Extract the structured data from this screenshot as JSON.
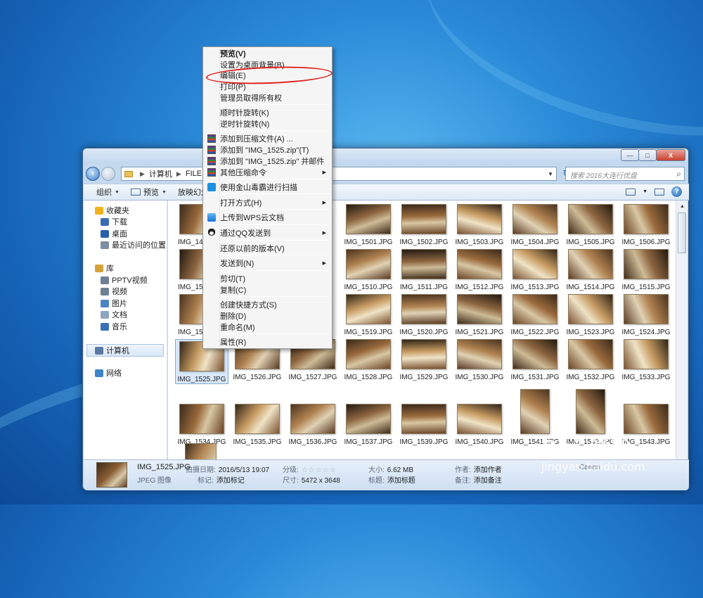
{
  "window": {
    "address": {
      "crumbs": [
        "计算机",
        "FILEBAK ("
      ]
    },
    "search_placeholder": "搜索 2016大连行优盘",
    "toolbar": {
      "organize": "组织",
      "preview": "预览",
      "slideshow": "放映幻灯片"
    },
    "caption_buttons": {
      "minimize": "—",
      "maximize": "□",
      "close": "X"
    },
    "nav": [
      {
        "label": "收藏夹",
        "icon": "star-icon",
        "color": "#f0b21e"
      },
      {
        "label": "下载",
        "icon": "download-icon",
        "color": "#3b6db3"
      },
      {
        "label": "桌面",
        "icon": "desktop-icon",
        "color": "#2b5fa8"
      },
      {
        "label": "最近访问的位置",
        "icon": "recent-places-icon",
        "color": "#7d8da2"
      },
      {
        "label": "库",
        "icon": "library-icon",
        "color": "#d8a23a"
      },
      {
        "label": "PPTV视频",
        "icon": "video-icon",
        "color": "#6f7f95"
      },
      {
        "label": "视频",
        "icon": "video-icon",
        "color": "#6f7f95"
      },
      {
        "label": "图片",
        "icon": "picture-icon",
        "color": "#4f84c2"
      },
      {
        "label": "文档",
        "icon": "document-icon",
        "color": "#8ea5c0"
      },
      {
        "label": "音乐",
        "icon": "music-icon",
        "color": "#3a6fb5"
      },
      {
        "label": "计算机",
        "icon": "computer-icon",
        "color": "#5a7aa5"
      },
      {
        "label": "网络",
        "icon": "network-icon",
        "color": "#3e85c8"
      }
    ],
    "thumbnails": [
      [
        "IMG_14",
        "",
        "",
        "IMG_1501.JPG",
        "IMG_1502.JPG",
        "IMG_1503.JPG",
        "IMG_1504.JPG",
        "IMG_1505.JPG",
        "IMG_1506.JPG"
      ],
      [
        "IMG_15",
        "",
        "",
        "IMG_1510.JPG",
        "IMG_1511.JPG",
        "IMG_1512.JPG",
        "IMG_1513.JPG",
        "IMG_1514.JPG",
        "IMG_1515.JPG"
      ],
      [
        "IMG_15",
        "",
        "",
        "IMG_1519.JPG",
        "IMG_1520.JPG",
        "IMG_1521.JPG",
        "IMG_1522.JPG",
        "IMG_1523.JPG",
        "IMG_1524.JPG"
      ],
      [
        "IMG_1525.JPG",
        "IMG_1526.JPG",
        "IMG_1527.JPG",
        "IMG_1528.JPG",
        "IMG_1529.JPG",
        "IMG_1530.JPG",
        "IMG_1531.JPG",
        "IMG_1532.JPG",
        "IMG_1533.JPG"
      ],
      [
        "IMG_1534.JPG",
        "IMG_1535.JPG",
        "IMG_1536.JPG",
        "IMG_1537.JPG",
        "IMG_1539.JPG",
        "IMG_1540.JPG",
        "IMG_1541.JPG",
        "IMG_1542.JPG",
        "IMG_1543.JPG"
      ]
    ],
    "details": {
      "filename": "IMG_1525.JPG",
      "type": "JPEG 图像",
      "shot_date_label": "拍摄日期:",
      "shot_date": "2016/5/13 19:07",
      "tags_label": "标记:",
      "tags": "添加标记",
      "rating_label": "分级:",
      "dimensions_label": "尺寸:",
      "dimensions": "5472 x 3648",
      "size_label": "大小:",
      "size": "6.62 MB",
      "title_label": "标题:",
      "title": "添加标题",
      "author_label": "作者:",
      "author": "添加作者",
      "comment_label": "备注:",
      "comment": "添加备注",
      "camera_partial": "Canon"
    }
  },
  "context_menu": {
    "items": [
      {
        "label": "预览(V)",
        "bold": true,
        "icon": ""
      },
      {
        "label": "设置为桌面背景(B)",
        "icon": ""
      },
      {
        "label": "编辑(E)",
        "icon": ""
      },
      {
        "label": "打印(P)",
        "icon": ""
      },
      {
        "label": "管理员取得所有权",
        "icon": ""
      },
      {
        "label": "顺时针旋转(K)",
        "icon": ""
      },
      {
        "label": "逆时针旋转(N)",
        "icon": ""
      },
      {
        "label": "添加到压缩文件(A) ...",
        "icon": "winrar-icon"
      },
      {
        "label": "添加到 \"IMG_1525.zip\"(T)",
        "icon": "winrar-icon"
      },
      {
        "label": "添加到 \"IMG_1525.zip\" 并邮件",
        "icon": "winrar-icon"
      },
      {
        "label": "其他压缩命令",
        "icon": "winrar-icon",
        "submenu": true
      },
      {
        "label": "使用金山毒霸进行扫描",
        "icon": "kingsoft-antivirus-icon"
      },
      {
        "label": "打开方式(H)",
        "icon": "",
        "submenu": true
      },
      {
        "label": "上传到WPS云文档",
        "icon": "wps-cloud-icon"
      },
      {
        "label": "通过QQ发送到",
        "icon": "qq-icon",
        "submenu": true
      },
      {
        "label": "还原以前的版本(V)",
        "icon": ""
      },
      {
        "label": "发送到(N)",
        "icon": "",
        "submenu": true
      },
      {
        "label": "剪切(T)",
        "icon": ""
      },
      {
        "label": "复制(C)",
        "icon": ""
      },
      {
        "label": "创建快捷方式(S)",
        "icon": ""
      },
      {
        "label": "删除(D)",
        "icon": ""
      },
      {
        "label": "重命名(M)",
        "icon": ""
      },
      {
        "label": "属性(R)",
        "icon": ""
      }
    ]
  },
  "watermark": {
    "logo": "Bai 经验",
    "url": "jingyan.baidu.com"
  }
}
